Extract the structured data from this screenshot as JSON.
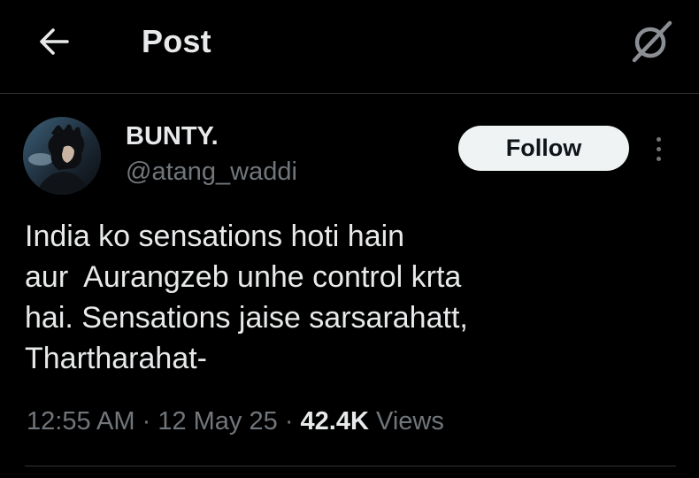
{
  "header": {
    "title": "Post",
    "back_icon": "arrow-left-icon",
    "grok_icon": "grok-icon"
  },
  "author": {
    "display_name": "BUNTY.",
    "handle": "@atang_waddi",
    "avatar_icon": "profile-avatar"
  },
  "follow_label": "Follow",
  "more_icon": "more-vertical-icon",
  "tweet": {
    "lines": [
      "India ko sensations hoti hain",
      "aur  Aurangzeb unhe control krta",
      "hai. Sensations jaise sarsarahatt,",
      "Thartharahat-"
    ]
  },
  "meta": {
    "time": "12:55 AM",
    "separator": "·",
    "date": "12 May 25",
    "views_count": "42.4K",
    "views_label": "Views"
  },
  "colors": {
    "background": "#000000",
    "text_primary": "#e7e9ea",
    "text_secondary": "#71767b",
    "follow_bg": "#eff3f4",
    "border": "#2f3336"
  }
}
